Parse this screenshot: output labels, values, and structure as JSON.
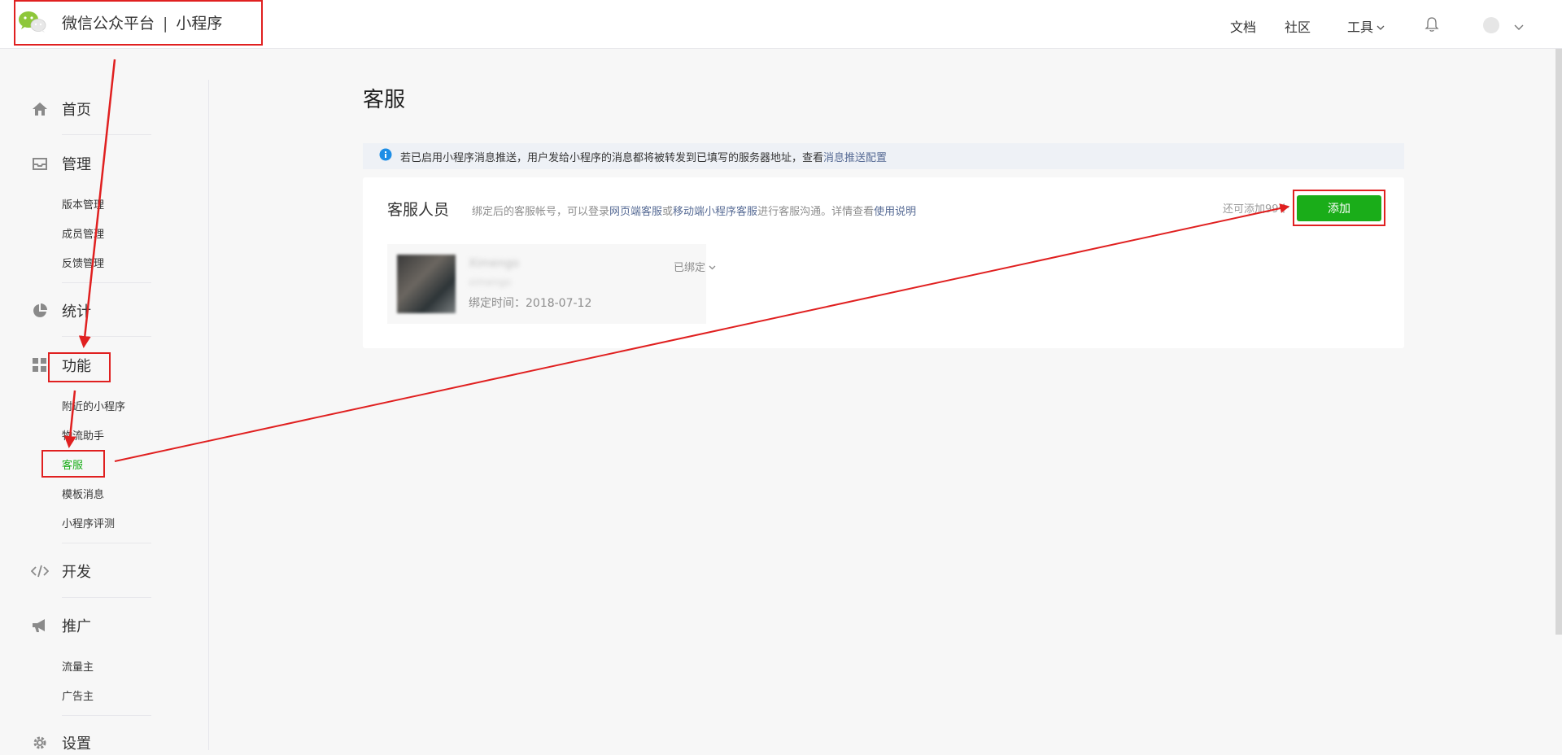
{
  "header": {
    "brand_main": "微信公众平台",
    "brand_sep": "|",
    "brand_sub": "小程序",
    "nav": [
      "文档",
      "社区",
      "工具"
    ]
  },
  "sidebar": {
    "home": "首页",
    "manage": {
      "label": "管理",
      "items": [
        "版本管理",
        "成员管理",
        "反馈管理"
      ]
    },
    "stats": "统计",
    "features": {
      "label": "功能",
      "items": [
        "附近的小程序",
        "物流助手",
        "客服",
        "模板消息",
        "小程序评测"
      ],
      "active": "客服"
    },
    "dev": "开发",
    "promo": {
      "label": "推广",
      "items": [
        "流量主",
        "广告主"
      ]
    },
    "settings": "设置"
  },
  "main": {
    "title": "客服",
    "notice": {
      "text": "若已启用小程序消息推送，用户发给小程序的消息都将被转发到已填写的服务器地址，查看",
      "link": "消息推送配置"
    },
    "panel": {
      "title": "客服人员",
      "desc_prefix": "绑定后的客服帐号，可以登录",
      "desc_link1": "网页端客服",
      "desc_mid": "或",
      "desc_link2": "移动端小程序客服",
      "desc_suffix": "进行客服沟通。详情查看",
      "desc_link3": "使用说明",
      "remaining": "还可添加99个",
      "add_button": "添加",
      "agent": {
        "name": "Ximengo",
        "id": "ximengo",
        "bind_time": "绑定时间：2018-07-12",
        "status": "已绑定"
      }
    }
  },
  "colors": {
    "accent_green": "#1aad19",
    "link_blue": "#576b95",
    "annotation_red": "#e02020"
  }
}
